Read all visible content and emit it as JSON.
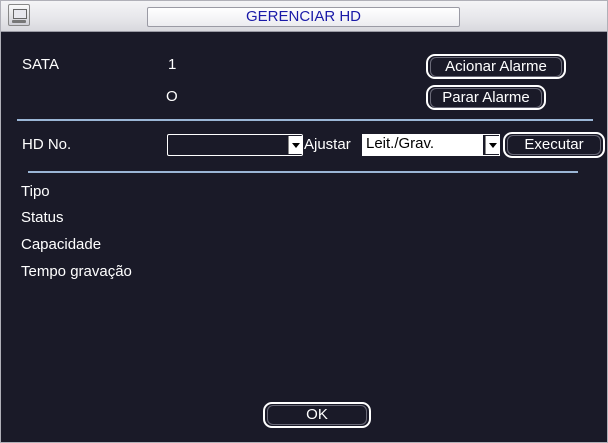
{
  "window": {
    "title": "GERENCIAR HD",
    "icon": "monitor-icon"
  },
  "sata": {
    "label": "SATA",
    "value1": "1",
    "value2": "O"
  },
  "alarm": {
    "trigger_label": "Acionar Alarme",
    "stop_label": "Parar Alarme"
  },
  "hd": {
    "label": "HD No.",
    "selected": "",
    "adjust_label": "Ajustar",
    "mode_value": "Leit./Grav.",
    "execute_label": "Executar"
  },
  "info": {
    "type_label": "Tipo",
    "status_label": "Status",
    "capacity_label": "Capacidade",
    "record_time_label": "Tempo gravação"
  },
  "footer": {
    "ok_label": "OK"
  },
  "colors": {
    "background": "#1a1a28",
    "title_text": "#1a1aa8",
    "separator": "#9bb6d6"
  }
}
